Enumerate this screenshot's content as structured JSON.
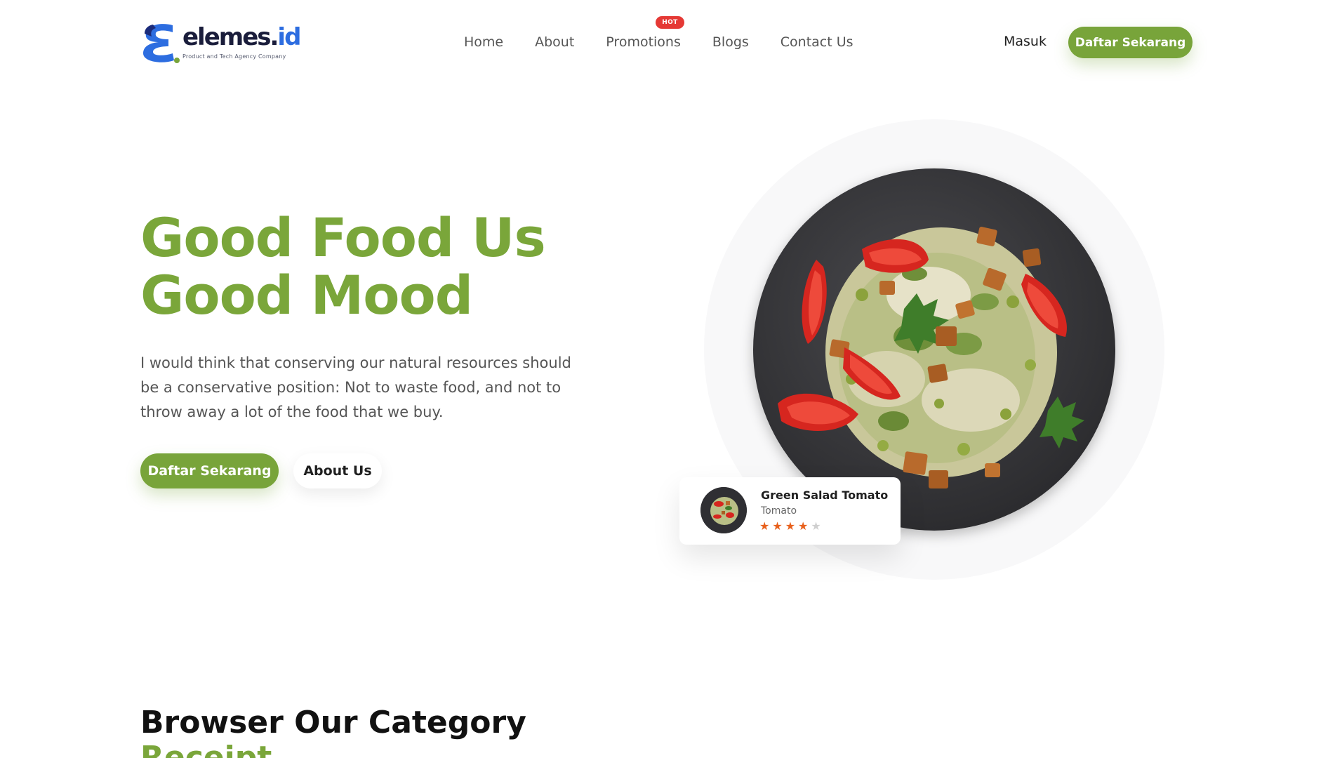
{
  "brand": {
    "name_main": "elemes.",
    "name_accent": "id",
    "tagline": "Product and Tech Agency Company",
    "colors": {
      "primary_green": "#78a43a",
      "logo_blue": "#2d6de0",
      "hot_red": "#e53935",
      "star_orange": "#e8601c"
    }
  },
  "nav": {
    "items": [
      {
        "label": "Home"
      },
      {
        "label": "About"
      },
      {
        "label": "Promotions",
        "badge": "HOT"
      },
      {
        "label": "Blogs"
      },
      {
        "label": "Contact Us"
      }
    ]
  },
  "header": {
    "login_label": "Masuk",
    "cta_label": "Daftar Sekarang"
  },
  "hero": {
    "title_line1": "Good Food Us",
    "title_line2": "Good Mood",
    "description": "I would think that conserving our natural resources should be a conservative position: Not to waste food, and not to throw away a lot of the food that we buy.",
    "primary_button": "Daftar Sekarang",
    "secondary_button": "About Us"
  },
  "food_card": {
    "name": "Green Salad Tomato",
    "subtitle": "Tomato",
    "rating": 4,
    "rating_max": 5,
    "stars": [
      "★",
      "★",
      "★",
      "★",
      "★"
    ]
  },
  "category": {
    "title": "Browser Our Category",
    "subtitle": "Receipt"
  }
}
